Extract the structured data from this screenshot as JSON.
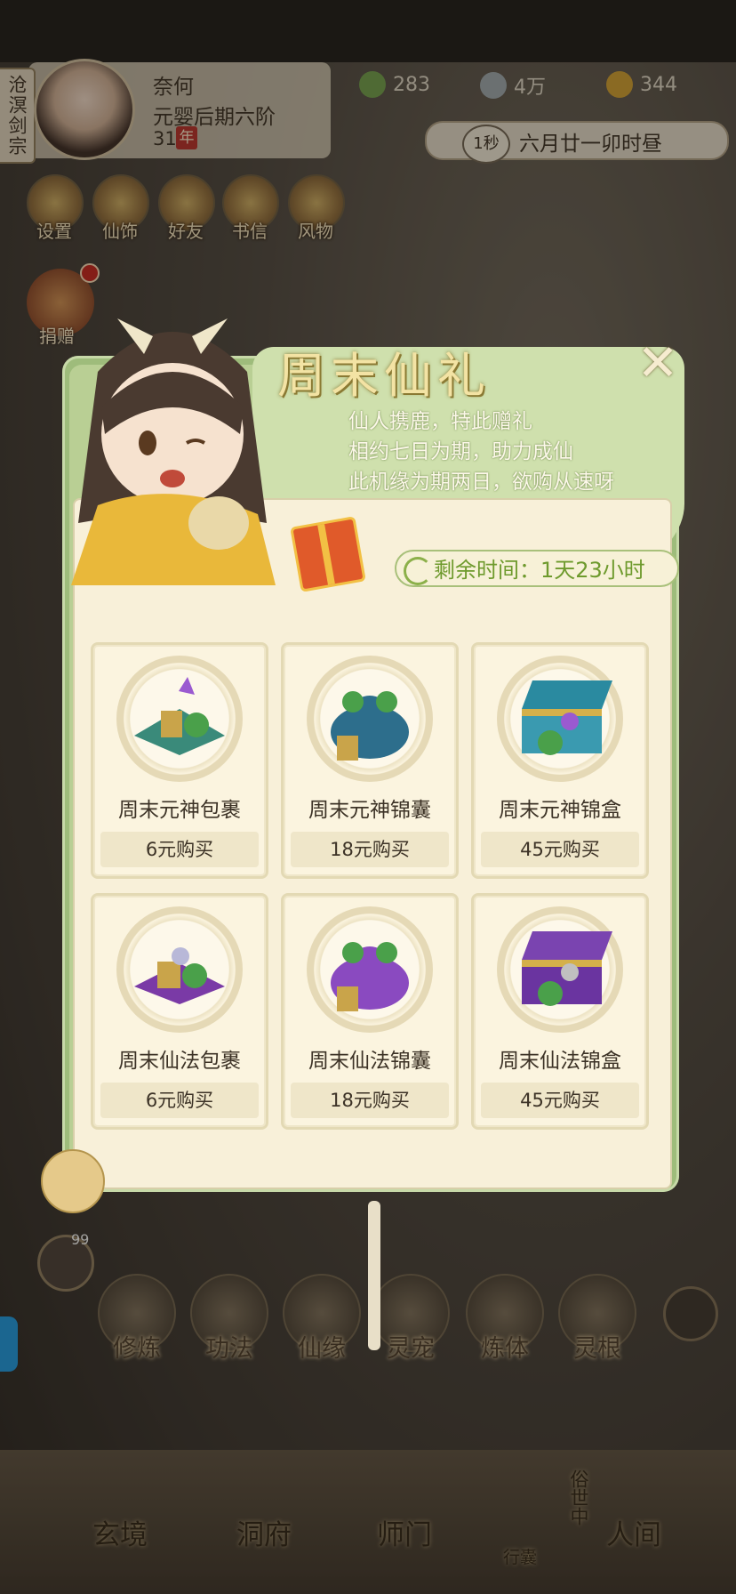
{
  "player": {
    "sect": "沧溟剑宗",
    "name": "奈何",
    "rank": "元婴后期六阶",
    "age": "31",
    "age_unit": "年"
  },
  "resources": [
    {
      "icon": "jade-leaf-icon",
      "value": "283"
    },
    {
      "icon": "coin-icon",
      "value": "4万"
    },
    {
      "icon": "gold-ingot-icon",
      "value": "344"
    }
  ],
  "clock": {
    "speed": "1秒",
    "date": "六月廿一卯时昼"
  },
  "top_buttons": [
    {
      "label": "设置",
      "icon": "settings-icon"
    },
    {
      "label": "仙饰",
      "icon": "costume-icon"
    },
    {
      "label": "好友",
      "icon": "friends-icon"
    },
    {
      "label": "书信",
      "icon": "letter-icon"
    },
    {
      "label": "风物",
      "icon": "scenery-icon"
    }
  ],
  "donate_label": "捐赠",
  "popup": {
    "title": "周末仙礼",
    "close": "✕",
    "desc": [
      "仙人携鹿，特此赠礼",
      "相约七日为期，助力成仙",
      "此机缘为期两日，欲购从速呀"
    ],
    "timer": "剩余时间：1天23小时",
    "items": [
      {
        "name": "周末元神包裹",
        "price": "6元购买",
        "color": "#3a8a7a"
      },
      {
        "name": "周末元神锦囊",
        "price": "18元购买",
        "color": "#2d6e8c"
      },
      {
        "name": "周末元神锦盒",
        "price": "45元购买",
        "color": "#3a9ab0"
      },
      {
        "name": "周末仙法包裹",
        "price": "6元购买",
        "color": "#7a3aa6"
      },
      {
        "name": "周末仙法锦囊",
        "price": "18元购买",
        "color": "#8a4ac0"
      },
      {
        "name": "周末仙法锦盒",
        "price": "45元购买",
        "color": "#6a34a0"
      }
    ]
  },
  "chat_badge": "99",
  "bottom_buttons": [
    "修炼",
    "功法",
    "仙缘",
    "灵宠",
    "炼体",
    "灵根"
  ],
  "nav": [
    "玄境",
    "洞府",
    "师门",
    "行囊",
    "俗世中",
    "人间"
  ]
}
